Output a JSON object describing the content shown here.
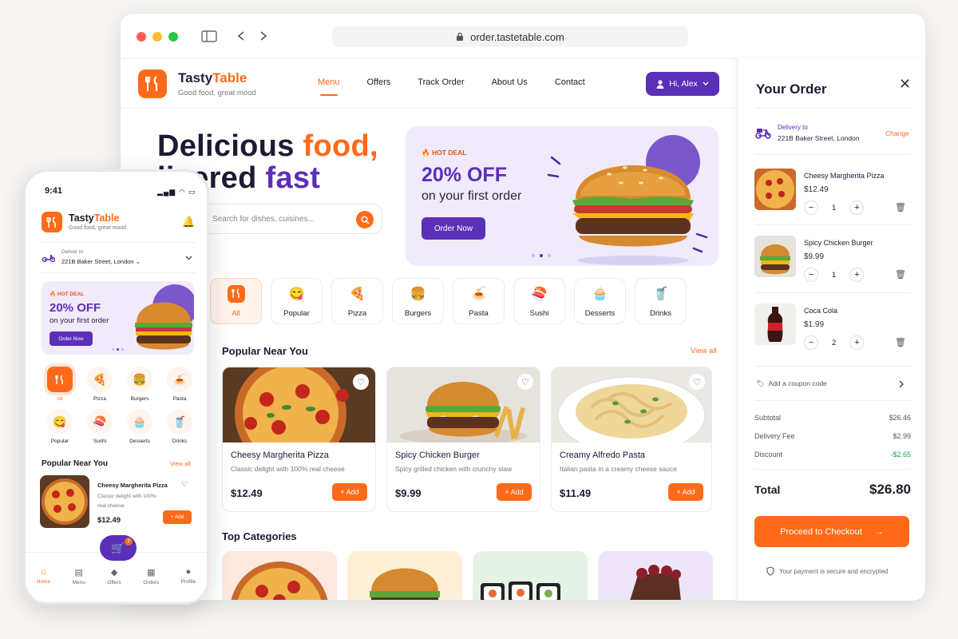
{
  "browser": {
    "url": "order.tastetable.com"
  },
  "brand": {
    "name_a": "Tasty",
    "name_b": "Table",
    "tagline": "Good food, great mood"
  },
  "nav": {
    "links": [
      "Menu",
      "Offers",
      "Track Order",
      "About Us",
      "Contact"
    ],
    "active": "Menu",
    "user_button": "Hi, Alex"
  },
  "hero": {
    "line1_a": "Delicious ",
    "line1_b": "food,",
    "line2_a": "livered ",
    "line2_b": "fast",
    "search_placeholder": "Search for dishes, cuisines..."
  },
  "promo": {
    "tag": "HOT DEAL",
    "headline": "20% OFF",
    "subline": "on your first order",
    "button": "Order Now",
    "active_slide": 2,
    "slides": 3
  },
  "categories": [
    {
      "label": "All",
      "icon": "utensils-icon",
      "active": true
    },
    {
      "label": "Popular",
      "icon": "smile-icon"
    },
    {
      "label": "Pizza",
      "icon": "pizza-icon"
    },
    {
      "label": "Burgers",
      "icon": "burger-icon"
    },
    {
      "label": "Pasta",
      "icon": "pasta-icon"
    },
    {
      "label": "Sushi",
      "icon": "sushi-icon"
    },
    {
      "label": "Desserts",
      "icon": "cupcake-icon"
    },
    {
      "label": "Drinks",
      "icon": "drink-icon"
    }
  ],
  "popular": {
    "title": "Popular Near You",
    "view_all": "View all",
    "items": [
      {
        "name": "Cheesy Margherita Pizza",
        "desc": "Classic delight with 100% real cheese",
        "price": "$12.49",
        "add": "+ Add"
      },
      {
        "name": "Spicy Chicken Burger",
        "desc": "Spicy grilled chicken with crunchy slaw",
        "price": "$9.99",
        "add": "+ Add"
      },
      {
        "name": "Creamy Alfredo Pasta",
        "desc": "Italian pasta in a creamy cheese sauce",
        "price": "$11.49",
        "add": "+ Add"
      }
    ]
  },
  "top_categories": {
    "title": "Top Categories"
  },
  "order": {
    "title": "Your Order",
    "delivery_label": "Delivery to",
    "address": "221B Baker Street, London",
    "change": "Change",
    "items": [
      {
        "name": "Cheesy Margherita Pizza",
        "price": "$12.49",
        "qty": "1"
      },
      {
        "name": "Spicy Chicken Burger",
        "price": "$9.99",
        "qty": "1"
      },
      {
        "name": "Coca Cola",
        "price": "$1.99",
        "qty": "2"
      }
    ],
    "coupon": "Add a coupon code",
    "subtotal_label": "Subtotal",
    "subtotal": "$26.46",
    "fee_label": "Delivery Fee",
    "fee": "$2.99",
    "discount_label": "Discount",
    "discount": "-$2.65",
    "total_label": "Total",
    "total": "$26.80",
    "checkout": "Proceed to Checkout",
    "secure": "Your payment is secure and encrypted"
  },
  "phone": {
    "time": "9:41",
    "deliver_label": "Deliver to",
    "address": "221B Baker Street, London",
    "categories": [
      "All",
      "Pizza",
      "Burgers",
      "Pasta",
      "Popular",
      "Sushi",
      "Desserts",
      "Drinks"
    ],
    "section": "Popular Near You",
    "view_all": "View all",
    "item": {
      "name": "Cheesy Margherita Pizza",
      "desc": "Classic delight with 100% real cheese",
      "price": "$12.49",
      "add": "+ Add"
    },
    "cart_count": "3",
    "tabs": [
      "Home",
      "Menu",
      "Offers",
      "Orders",
      "Profile"
    ]
  },
  "colors": {
    "accent": "#ff6a1a",
    "brand": "#5b2fb8",
    "discount": "#22a355"
  }
}
